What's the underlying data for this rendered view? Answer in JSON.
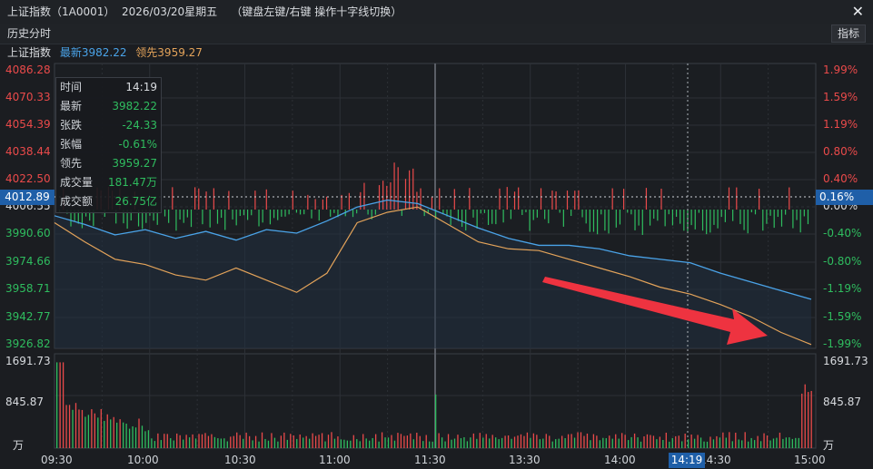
{
  "window": {
    "title": "上证指数（1A0001）  2026/03/20星期五    （键盘左键/右键 操作十字线切换）",
    "close_icon": "close-icon"
  },
  "toolbar": {
    "history_label": "历史分时",
    "indicator_button": "指标"
  },
  "legend": {
    "name": "上证指数",
    "latest_label": "最新3982.22",
    "lead_label": "领先3959.27"
  },
  "colors": {
    "up": "#ea4a4a",
    "down": "#2fbd5f",
    "price_line": "#4aa3e8",
    "lead_line": "#e3a35a",
    "accent": "#1f5fa8"
  },
  "price_axis": {
    "left": [
      "4086.28",
      "4070.33",
      "4054.39",
      "4038.44",
      "4022.50",
      "4006.55",
      "3990.60",
      "3974.66",
      "3958.71",
      "3942.77",
      "3926.82"
    ],
    "right": [
      "1.99%",
      "1.59%",
      "1.19%",
      "0.80%",
      "0.40%",
      "0.00%",
      "-0.40%",
      "-0.80%",
      "-1.19%",
      "-1.59%",
      "-1.99%"
    ],
    "current_left": "4012.89",
    "current_right": "0.16%"
  },
  "volume_axis": {
    "top": "1691.73",
    "mid": "845.87",
    "unit": "万"
  },
  "time_axis": [
    "09:30",
    "10:00",
    "10:30",
    "11:00",
    "11:30",
    "13:30",
    "14:00",
    "14:30",
    "15:00"
  ],
  "cursor_time": "14:19",
  "tooltip": [
    {
      "k": "时间",
      "v": "14:19",
      "c": "white"
    },
    {
      "k": "最新",
      "v": "3982.22",
      "c": "green"
    },
    {
      "k": "张跌",
      "v": "-24.33",
      "c": "green"
    },
    {
      "k": "张幅",
      "v": "-0.61%",
      "c": "green"
    },
    {
      "k": "领先",
      "v": "3959.27",
      "c": "green"
    },
    {
      "k": "成交量",
      "v": "181.47万",
      "c": "green"
    },
    {
      "k": "成交额",
      "v": "26.75亿",
      "c": "green"
    }
  ],
  "chart_data": {
    "type": "line",
    "ylim": [
      3926.82,
      4086.28
    ],
    "prev_close": 4006.55,
    "x": [
      "09:30",
      "10:00",
      "10:30",
      "11:00",
      "11:30",
      "13:30",
      "14:00",
      "14:30",
      "15:00"
    ],
    "series": [
      {
        "name": "最新",
        "values": [
          4003,
          3998,
          3992,
          3995,
          3990,
          3994,
          3989,
          3995,
          3993,
          4000,
          4008,
          4012,
          4010,
          4003,
          3996,
          3990,
          3986,
          3986,
          3984,
          3980,
          3978,
          3976,
          3970,
          3965,
          3960,
          3955
        ]
      },
      {
        "name": "领先",
        "values": [
          3999,
          3988,
          3978,
          3975,
          3969,
          3966,
          3973,
          3966,
          3959,
          3970,
          3999,
          4005,
          4008,
          3998,
          3988,
          3984,
          3983,
          3978,
          3973,
          3968,
          3962,
          3958,
          3952,
          3945,
          3936,
          3929
        ]
      }
    ],
    "volume_ymax": 1691.73
  }
}
